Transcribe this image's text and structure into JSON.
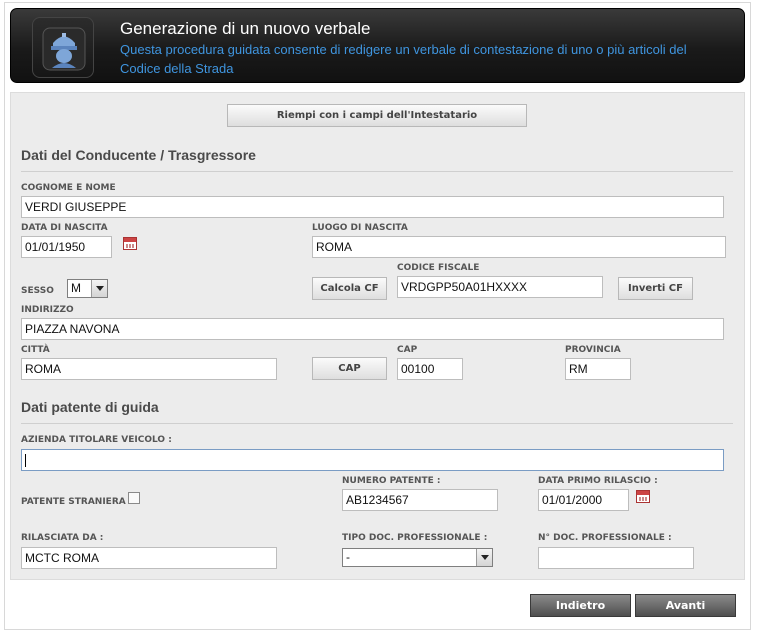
{
  "header": {
    "title": "Generazione di un nuovo verbale",
    "subtitle": "Questa procedura guidata consente di redigere un verbale di contestazione di uno o più articoli del Codice della Strada",
    "icon": "police-officer-icon"
  },
  "fill_button": "Riempi con i campi dell'Intestatario",
  "driver_section": {
    "title": "Dati del Conducente / Trasgressore",
    "cognome_nome": {
      "label": "COGNOME E NOME",
      "value": "VERDI GIUSEPPE"
    },
    "data_nascita": {
      "label": "DATA DI NASCITA",
      "value": "01/01/1950"
    },
    "luogo_nascita": {
      "label": "LUOGO DI NASCITA",
      "value": "ROMA"
    },
    "sesso": {
      "label": "SESSO",
      "value": "M"
    },
    "calcola_cf": "Calcola CF",
    "codice_fiscale": {
      "label": "CODICE FISCALE",
      "value": "VRDGPP50A01HXXXX"
    },
    "inverti_cf": "Inverti CF",
    "indirizzo": {
      "label": "INDIRIZZO",
      "value": "PIAZZA NAVONA"
    },
    "citta": {
      "label": "CITTÀ",
      "value": "ROMA"
    },
    "cap_button": "CAP",
    "cap": {
      "label": "CAP",
      "value": "00100"
    },
    "provincia": {
      "label": "PROVINCIA",
      "value": "RM"
    }
  },
  "license_section": {
    "title": "Dati patente di guida",
    "azienda": {
      "label": "AZIENDA TITOLARE VEICOLO :",
      "value": ""
    },
    "patente_straniera": {
      "label": "PATENTE STRANIERA :",
      "checked": false
    },
    "numero_patente": {
      "label": "NUMERO PATENTE :",
      "value": "AB1234567"
    },
    "data_primo_rilascio": {
      "label": "DATA PRIMO RILASCIO :",
      "value": "01/01/2000"
    },
    "rilasciata_da": {
      "label": "RILASCIATA DA :",
      "value": "MCTC ROMA"
    },
    "tipo_doc": {
      "label": "TIPO DOC. PROFESSIONALE :",
      "value": "-"
    },
    "n_doc": {
      "label": "N° DOC. PROFESSIONALE :",
      "value": ""
    }
  },
  "footer": {
    "back_label": "Indietro",
    "next_label": "Avanti"
  },
  "colors": {
    "header_bg": "#1a1a1a",
    "subtitle": "#3f95df",
    "panel_bg": "#ececec"
  }
}
